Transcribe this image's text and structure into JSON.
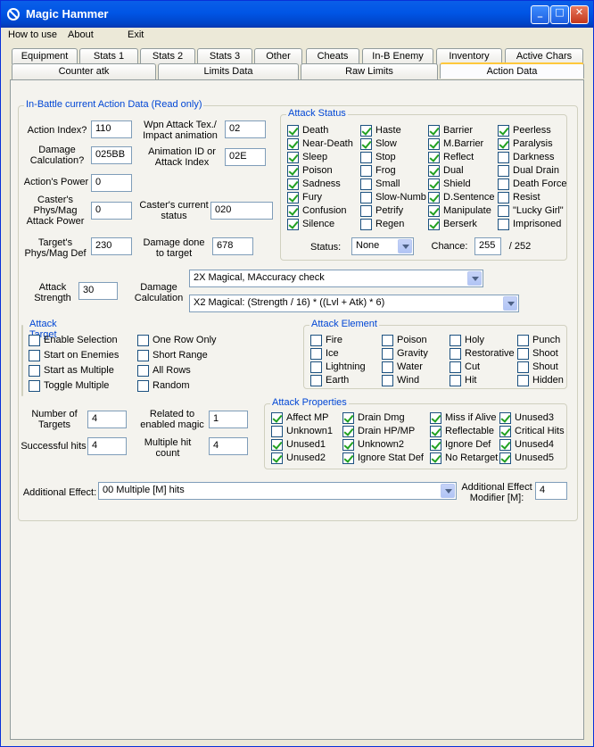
{
  "window": {
    "title": "Magic Hammer"
  },
  "menu": [
    "How to use",
    "About",
    "Exit"
  ],
  "tabs_row1": [
    "Equipment",
    "Stats 1",
    "Stats 2",
    "Stats 3",
    "Other",
    "Cheats",
    "In-B Enemy",
    "Inventory",
    "Active Chars"
  ],
  "tabs_row2": [
    "Counter atk",
    "Limits Data",
    "Raw Limits",
    "Action Data"
  ],
  "main": {
    "title": "In-Battle current Action Data (Read only)",
    "action_index": {
      "label": "Action Index?",
      "value": "110"
    },
    "damage_calc": {
      "label": "Damage Calculation?",
      "value": "025BB"
    },
    "action_power": {
      "label": "Action's Power",
      "value": "0"
    },
    "caster_attack": {
      "label": "Caster's Phys/Mag Attack Power",
      "value": "0"
    },
    "target_def": {
      "label": "Target's Phys/Mag Def",
      "value": "230"
    },
    "wpn_attack": {
      "label": "Wpn Attack Tex./ Impact animation",
      "value": "02"
    },
    "animation_id": {
      "label": "Animation ID or Attack Index",
      "value": "02E"
    },
    "caster_status": {
      "label": "Caster's current status",
      "value": "020"
    },
    "damage_done": {
      "label": "Damage done to target",
      "value": "678"
    },
    "attack_strength": {
      "label": "Attack Strength",
      "value": "30"
    },
    "damage_calculation": {
      "label": "Damage Calculation",
      "select1": "2X Magical, MAccuracy check",
      "select2": "X2 Magical: (Strength / 16) * ((Lvl + Atk) * 6)"
    },
    "num_targets": {
      "label": "Number of Targets",
      "value": "4"
    },
    "successful_hits": {
      "label": "Successful hits",
      "value": "4"
    },
    "related_magic": {
      "label": "Related to enabled magic",
      "value": "1"
    },
    "multiple_hit": {
      "label": "Multiple hit count",
      "value": "4"
    },
    "additional_effect": {
      "label": "Additional Effect:",
      "value": "00 Multiple [M] hits"
    },
    "effect_modifier": {
      "label": "Additional Effect Modifier [M]:",
      "value": "4"
    }
  },
  "attack_status": {
    "title": "Attack Status",
    "items": [
      {
        "label": "Death",
        "checked": true
      },
      {
        "label": "Haste",
        "checked": true
      },
      {
        "label": "Barrier",
        "checked": true
      },
      {
        "label": "Peerless",
        "checked": true
      },
      {
        "label": "Near-Death",
        "checked": true
      },
      {
        "label": "Slow",
        "checked": true
      },
      {
        "label": "M.Barrier",
        "checked": true
      },
      {
        "label": "Paralysis",
        "checked": true
      },
      {
        "label": "Sleep",
        "checked": true
      },
      {
        "label": "Stop",
        "checked": false
      },
      {
        "label": "Reflect",
        "checked": true
      },
      {
        "label": "Darkness",
        "checked": false
      },
      {
        "label": "Poison",
        "checked": true
      },
      {
        "label": "Frog",
        "checked": false
      },
      {
        "label": "Dual",
        "checked": true
      },
      {
        "label": "Dual Drain",
        "checked": false
      },
      {
        "label": "Sadness",
        "checked": true
      },
      {
        "label": "Small",
        "checked": false
      },
      {
        "label": "Shield",
        "checked": true
      },
      {
        "label": "Death Force",
        "checked": false
      },
      {
        "label": "Fury",
        "checked": true
      },
      {
        "label": "Slow-Numb",
        "checked": false
      },
      {
        "label": "D.Sentence",
        "checked": true
      },
      {
        "label": "Resist",
        "checked": false
      },
      {
        "label": "Confusion",
        "checked": true
      },
      {
        "label": "Petrify",
        "checked": false
      },
      {
        "label": "Manipulate",
        "checked": true
      },
      {
        "label": "\"Lucky Girl\"",
        "checked": false
      },
      {
        "label": "Silence",
        "checked": true
      },
      {
        "label": "Regen",
        "checked": false
      },
      {
        "label": "Berserk",
        "checked": true
      },
      {
        "label": "Imprisoned",
        "checked": false
      }
    ],
    "status_label": "Status:",
    "status_value": "None",
    "chance_label": "Chance:",
    "chance_value": "255",
    "chance_max": "/ 252"
  },
  "attack_target": {
    "title": "Attack Target",
    "items": [
      {
        "label": "Enable Selection",
        "checked": false
      },
      {
        "label": "One Row Only",
        "checked": false
      },
      {
        "label": "Start on Enemies",
        "checked": false
      },
      {
        "label": "Short Range",
        "checked": false
      },
      {
        "label": "Start as Multiple",
        "checked": false
      },
      {
        "label": "All Rows",
        "checked": false
      },
      {
        "label": "Toggle Multiple",
        "checked": false
      },
      {
        "label": "Random",
        "checked": false
      }
    ]
  },
  "attack_element": {
    "title": "Attack Element",
    "items": [
      {
        "label": "Fire",
        "checked": false
      },
      {
        "label": "Poison",
        "checked": false
      },
      {
        "label": "Holy",
        "checked": false
      },
      {
        "label": "Punch",
        "checked": false
      },
      {
        "label": "Ice",
        "checked": false
      },
      {
        "label": "Gravity",
        "checked": false
      },
      {
        "label": "Restorative",
        "checked": false
      },
      {
        "label": "Shoot",
        "checked": false
      },
      {
        "label": "Lightning",
        "checked": false
      },
      {
        "label": "Water",
        "checked": false
      },
      {
        "label": "Cut",
        "checked": false
      },
      {
        "label": "Shout",
        "checked": false
      },
      {
        "label": "Earth",
        "checked": false
      },
      {
        "label": "Wind",
        "checked": false
      },
      {
        "label": "Hit",
        "checked": false
      },
      {
        "label": "Hidden",
        "checked": false
      }
    ]
  },
  "attack_properties": {
    "title": "Attack Properties",
    "items": [
      {
        "label": "Affect MP",
        "checked": true
      },
      {
        "label": "Drain Dmg",
        "checked": true
      },
      {
        "label": "Miss if Alive",
        "checked": true
      },
      {
        "label": "Unused3",
        "checked": true
      },
      {
        "label": "Unknown1",
        "checked": false
      },
      {
        "label": "Drain HP/MP",
        "checked": true
      },
      {
        "label": "Reflectable",
        "checked": true
      },
      {
        "label": "Critical Hits",
        "checked": true
      },
      {
        "label": "Unused1",
        "checked": true
      },
      {
        "label": "Unknown2",
        "checked": true
      },
      {
        "label": "Ignore Def",
        "checked": true
      },
      {
        "label": "Unused4",
        "checked": true
      },
      {
        "label": "Unused2",
        "checked": true
      },
      {
        "label": "Ignore Stat Def",
        "checked": true
      },
      {
        "label": "No Retarget",
        "checked": true
      },
      {
        "label": "Unused5",
        "checked": true
      }
    ]
  }
}
